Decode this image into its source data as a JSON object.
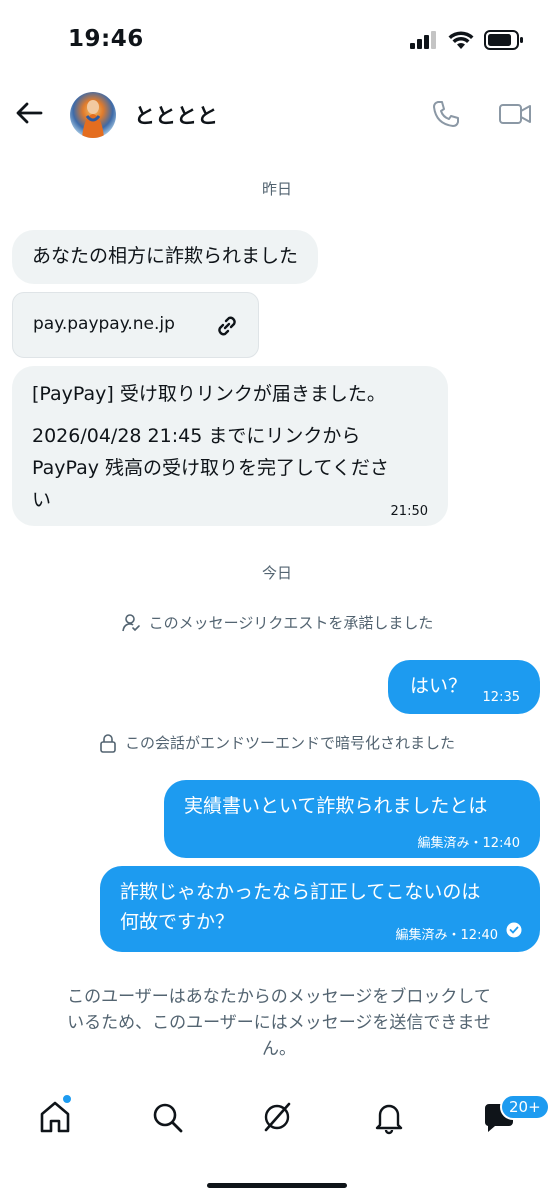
{
  "status_bar": {
    "time": "19:46"
  },
  "header": {
    "name": "とととと"
  },
  "conversation": {
    "yesterday_label": "昨日",
    "today_label": "今日",
    "incoming": {
      "message1": "あなたの相方に詐欺られました",
      "link_text": "pay.paypay.ne.jp",
      "message2_line1": "[PayPay] 受け取りリンクが届きました。",
      "message2_line2": "2026/04/28 21:45 までにリンクから",
      "message2_line3": "PayPay 残高の受け取りを完了してくださ",
      "message2_line4": "い",
      "message2_time": "21:50"
    },
    "request_accepted": "このメッセージリクエストを承諾しました",
    "encrypted_notice": "この会話がエンドツーエンドで暗号化されました",
    "outgoing": {
      "reply1": "はい？",
      "reply1_time": "12:35",
      "reply2": "実績書いといて詐欺られましたとは",
      "reply2_meta": "編集済み・12:40",
      "reply3_line1": "詐欺じゃなかったなら訂正してこないのは",
      "reply3_line2": "何故ですか？",
      "reply3_meta": "編集済み・12:40"
    },
    "blocked_notice_line1": "このユーザーはあなたからのメッセージをブロックして",
    "blocked_notice_line2": "いるため、このユーザーにはメッセージを送信できませ",
    "blocked_notice_line3": "ん。"
  },
  "tabbar": {
    "icons": [
      "home-icon",
      "search-icon",
      "grok-icon",
      "bell-icon",
      "messages-icon"
    ],
    "messages_badge": "20+"
  },
  "colors": {
    "accent": "#1d9bf0",
    "bubble_in": "#eff3f4",
    "muted": "#536471"
  }
}
